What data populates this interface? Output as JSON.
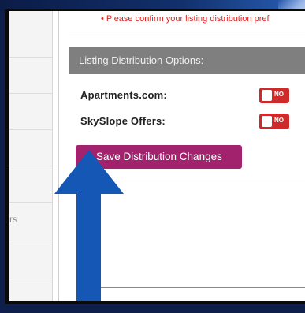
{
  "warning": "• Please confirm your listing distribution pref",
  "panel": {
    "title": "Listing Distribution Options:"
  },
  "options": [
    {
      "label": "Apartments.com:",
      "toggle_text": "NO"
    },
    {
      "label": "SkySlope Offers:",
      "toggle_text": "NO"
    }
  ],
  "save_button": {
    "label": "Save Distribution Changes"
  },
  "sidebar": {
    "fragment": "rs"
  },
  "colors": {
    "toggle_off": "#ce2a2a",
    "save_button": "#a3226e",
    "arrow": "#1557b5"
  }
}
